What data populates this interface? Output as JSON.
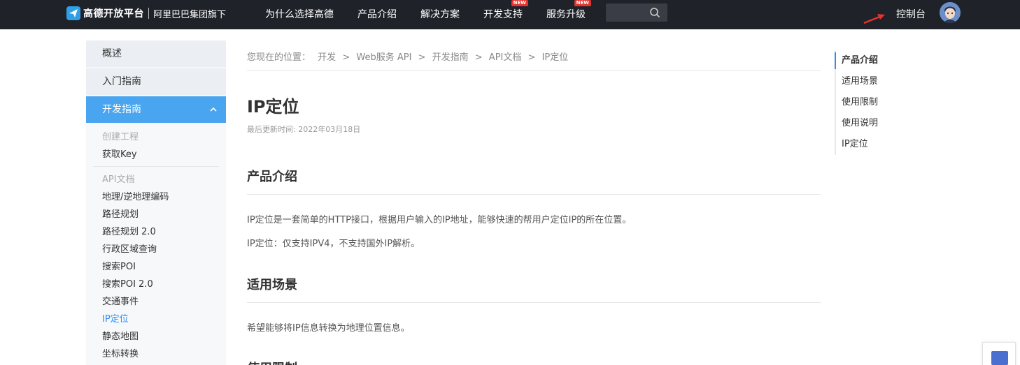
{
  "header": {
    "logo_text": "高德开放平台",
    "logo_sub": "阿里巴巴集团旗下",
    "nav": [
      {
        "label": "为什么选择高德",
        "badge": ""
      },
      {
        "label": "产品介绍",
        "badge": ""
      },
      {
        "label": "解决方案",
        "badge": ""
      },
      {
        "label": "开发支持",
        "badge": "NEW"
      },
      {
        "label": "服务升级",
        "badge": "NEW"
      }
    ],
    "search_placeholder": "",
    "console_label": "控制台",
    "colors": {
      "bar": "#1f2229",
      "badge": "#e3342f",
      "arrow": "#e3342f"
    }
  },
  "sidebar": {
    "heads": [
      "概述",
      "入门指南",
      "开发指南"
    ],
    "group1_items": [
      "创建工程",
      "获取Key"
    ],
    "group2_title": "API文档",
    "group2_items": [
      "地理/逆地理编码",
      "路径规划",
      "路径规划 2.0",
      "行政区域查询",
      "搜索POI",
      "搜索POI 2.0",
      "交通事件",
      "IP定位",
      "静态地图",
      "坐标转换"
    ],
    "current_item": "IP定位",
    "active_color": "#49a5f0"
  },
  "breadcrumb": {
    "prefix": "您现在的位置：",
    "items": [
      "开发",
      "Web服务 API",
      "开发指南",
      "API文档",
      "IP定位"
    ],
    "sep": ">"
  },
  "main": {
    "title": "IP定位",
    "updated": "最后更新时间: 2022年03月18日",
    "sections": [
      {
        "heading": "产品介绍",
        "paragraphs": [
          "IP定位是一套简单的HTTP接口，根据用户输入的IP地址，能够快速的帮用户定位IP的所在位置。",
          "IP定位：仅支持IPV4，不支持国外IP解析。"
        ]
      },
      {
        "heading": "适用场景",
        "paragraphs": [
          "希望能够将IP信息转换为地理位置信息。"
        ]
      },
      {
        "heading": "使用限制",
        "paragraphs": []
      }
    ]
  },
  "toc": {
    "items": [
      "产品介绍",
      "适用场景",
      "使用限制",
      "使用说明",
      "IP定位"
    ],
    "active_index": 0
  }
}
